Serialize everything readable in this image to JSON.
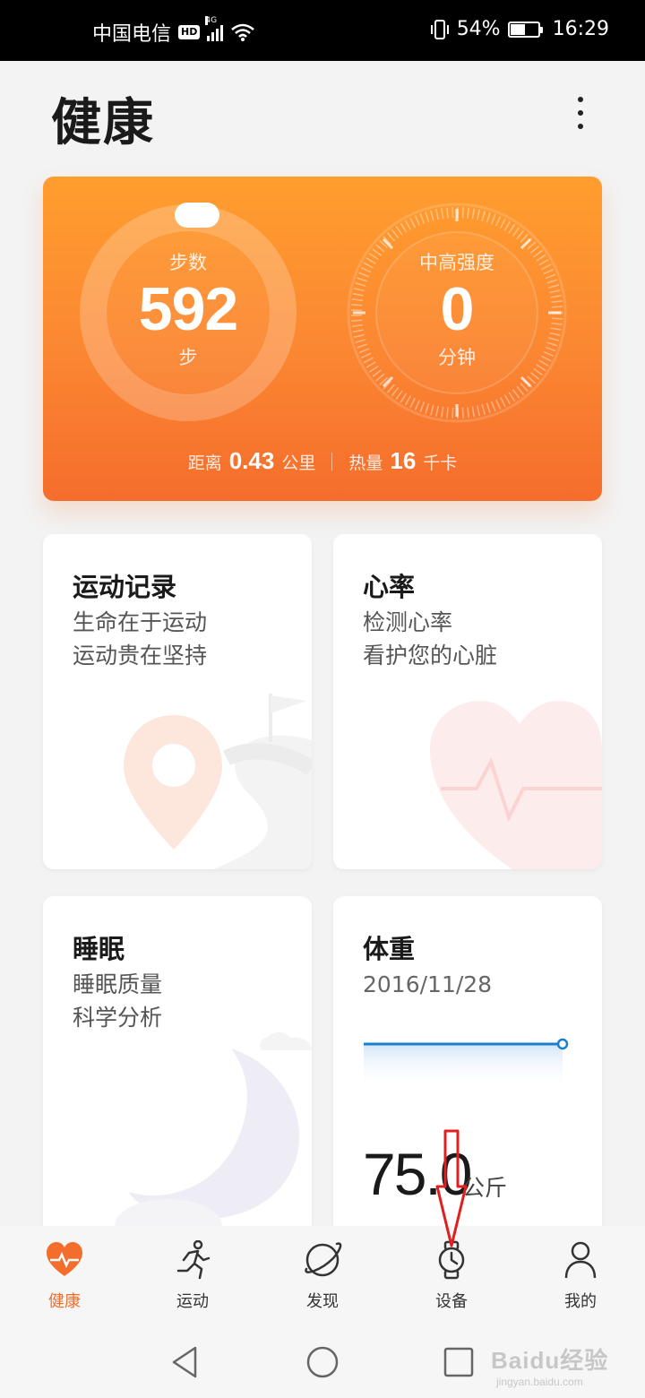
{
  "status_bar": {
    "carrier": "中国电信",
    "hd": "HD",
    "network": "4G",
    "battery": "54%",
    "battery_level": 0.54,
    "time": "16:29"
  },
  "header": {
    "title": "健康",
    "more_icon": "more-vertical-icon"
  },
  "summary": {
    "steps": {
      "label": "步数",
      "value": "592",
      "unit": "步"
    },
    "intensity": {
      "label": "中高强度",
      "value": "0",
      "unit": "分钟"
    },
    "distance": {
      "label": "距离",
      "value": "0.43",
      "unit": "公里"
    },
    "calories": {
      "label": "热量",
      "value": "16",
      "unit": "千卡"
    }
  },
  "tiles": {
    "exercise": {
      "title": "运动记录",
      "line1": "生命在于运动",
      "line2": "运动贵在坚持",
      "icon": "map-pin-icon"
    },
    "heart": {
      "title": "心率",
      "line1": "检测心率",
      "line2": "看护您的心脏",
      "icon": "heart-pulse-icon"
    },
    "sleep": {
      "title": "睡眠",
      "line1": "睡眠质量",
      "line2": "科学分析",
      "icon": "moon-icon"
    },
    "weight": {
      "title": "体重",
      "date": "2016/11/28",
      "value": "75.0",
      "unit": "公斤"
    }
  },
  "bottom_nav": [
    {
      "label": "健康",
      "icon": "heart-pulse-icon",
      "active": true
    },
    {
      "label": "运动",
      "icon": "running-icon",
      "active": false
    },
    {
      "label": "发现",
      "icon": "planet-icon",
      "active": false
    },
    {
      "label": "设备",
      "icon": "watch-icon",
      "active": false
    },
    {
      "label": "我的",
      "icon": "person-icon",
      "active": false
    }
  ],
  "watermark": {
    "main": "Baidu经验",
    "sub": "jingyan.baidu.com"
  },
  "colors": {
    "accent": "#f56d2c",
    "card_top": "#ff9e2e",
    "card_bottom": "#f56d2c",
    "line_blue": "#1a7fd0",
    "annotation": "#e02020"
  }
}
